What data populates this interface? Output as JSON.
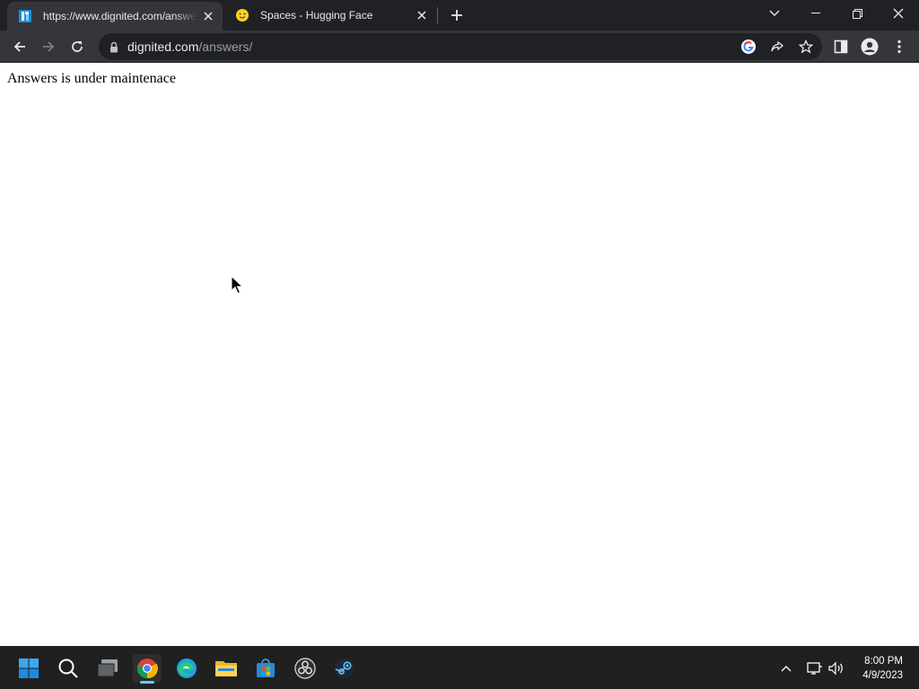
{
  "browser": {
    "tabs": [
      {
        "title": "https://www.dignited.com/answers/",
        "favicon": "dignited-icon",
        "active": true
      },
      {
        "title": "Spaces - Hugging Face",
        "favicon": "hugging-face-icon",
        "active": false
      }
    ],
    "omnibox": {
      "url_host": "dignited.com",
      "url_path": "/answers/"
    }
  },
  "page": {
    "message": "Answers is under maintenace"
  },
  "taskbar": {
    "apps": [
      "windows-start-icon",
      "search-icon",
      "task-view-icon",
      "chrome-icon",
      "edge-icon",
      "file-explorer-icon",
      "microsoft-store-icon",
      "obs-icon",
      "steam-icon"
    ],
    "clock": {
      "time": "8:00 PM",
      "date": "4/9/2023"
    }
  },
  "colors": {
    "tabstrip_bg": "#202124",
    "toolbar_bg": "#35363a",
    "taskbar_bg": "#202020",
    "accent": "#60cdff"
  }
}
